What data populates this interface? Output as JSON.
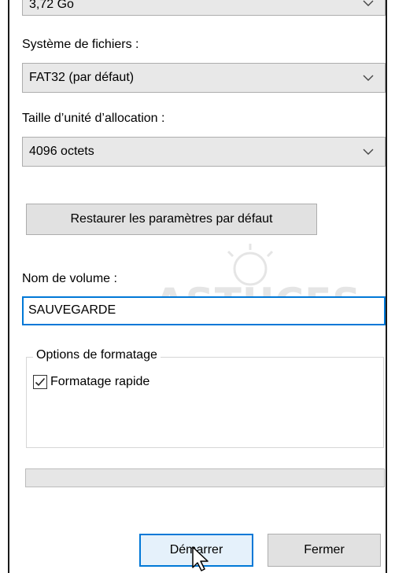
{
  "capacity": {
    "value": "3,72 Go"
  },
  "filesystem": {
    "label": "Système de fichiers :",
    "value": "FAT32 (par défaut)"
  },
  "allocation": {
    "label": "Taille d’unité d’allocation :",
    "value": "4096 octets"
  },
  "restore_button": {
    "label": "Restaurer les paramètres par défaut"
  },
  "volume": {
    "label": "Nom de volume :",
    "value": "SAUVEGARDE"
  },
  "format_options": {
    "legend": "Options de formatage",
    "quick_format": {
      "label": "Formatage rapide",
      "checked": true
    }
  },
  "progress": {
    "value": 0
  },
  "buttons": {
    "start": "Démarrer",
    "close": "Fermer"
  },
  "watermark": {
    "text": "ASTUCES"
  },
  "colors": {
    "accent": "#0078d7",
    "button_bg": "#e1e1e1",
    "combo_bg": "#e8e8e8"
  },
  "icons": {
    "dropdown": "chevron-down-icon",
    "check": "checkmark-icon",
    "cursor": "mouse-pointer-icon"
  }
}
